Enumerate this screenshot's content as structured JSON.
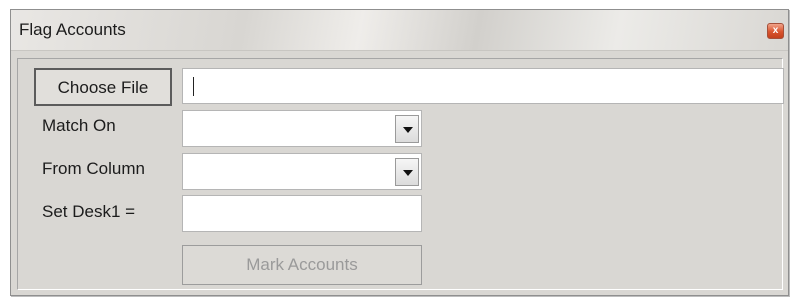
{
  "window": {
    "title": "Flag Accounts",
    "close_glyph": "x"
  },
  "form": {
    "choose_file_label": "Choose File",
    "file_path_value": "",
    "match_on_label": "Match On",
    "match_on_value": "",
    "from_column_label": "From Column",
    "from_column_value": "",
    "set_desk_label": "Set Desk1 =",
    "set_desk_value": "",
    "mark_accounts_label": "Mark Accounts"
  },
  "icons": {
    "close": "close-icon",
    "dropdown": "chevron-down-icon"
  },
  "colors": {
    "window_bg": "#d9d7d3",
    "close_button": "#d9542e",
    "disabled_text": "#9a9a9a"
  }
}
